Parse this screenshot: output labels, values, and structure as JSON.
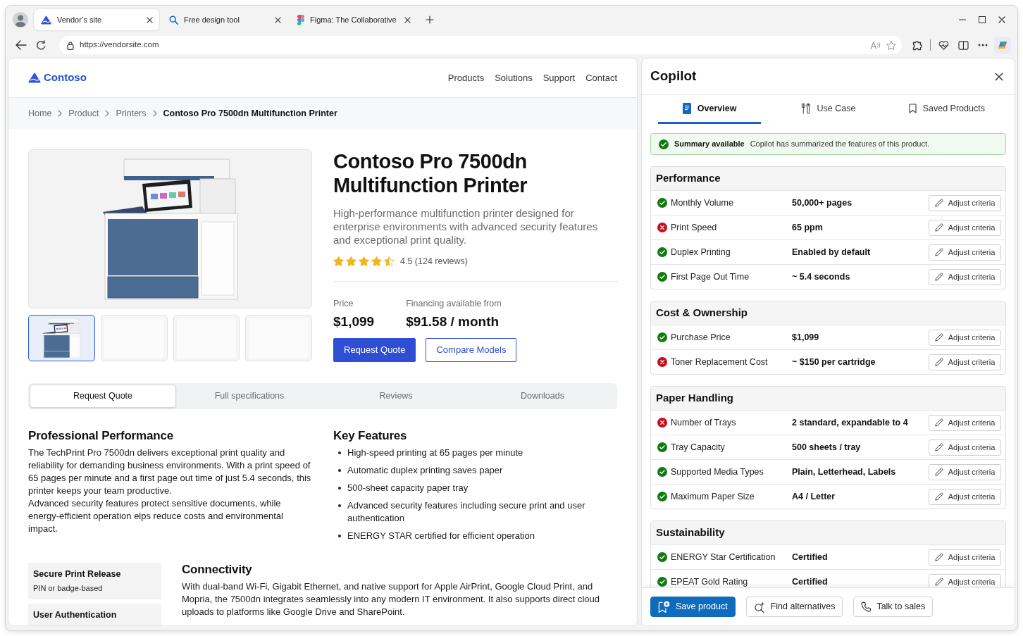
{
  "browser": {
    "tabs": [
      {
        "title": "Vendor’s site",
        "selected": true
      },
      {
        "title": "Free design tool",
        "selected": false
      },
      {
        "title": "Figma: The Collaborative",
        "selected": false
      }
    ],
    "address": "https://vendorsite.com"
  },
  "site": {
    "brand": "Contoso",
    "nav": [
      "Products",
      "Solutions",
      "Support",
      "Contact"
    ],
    "breadcrumb": [
      {
        "label": "Home",
        "current": false
      },
      {
        "label": "Product",
        "current": false
      },
      {
        "label": "Printers",
        "current": false
      },
      {
        "label": "Contoso Pro 7500dn Multifunction Printer",
        "current": true
      }
    ],
    "thumbnails": [
      {
        "selected": true
      },
      {
        "selected": false
      },
      {
        "selected": false
      },
      {
        "selected": false
      }
    ],
    "product": {
      "title": "Contoso Pro 7500dn Multifunction Printer",
      "description": "High-performance multifunction printer designed for enterprise environments with advanced security features and exceptional print quality.",
      "stars": 4.5,
      "rating": "4.5 (124 reviews)",
      "price_label": "Price",
      "price": "$1,099",
      "financing_label": "Financing available from",
      "financing": "$91.58 / month",
      "buttons": [
        {
          "label": "Request Quote",
          "primary": true
        },
        {
          "label": "Compare Models",
          "primary": false
        }
      ]
    },
    "tabs": [
      {
        "label": "Request Quote",
        "selected": true
      },
      {
        "label": "Full specifications",
        "selected": false
      },
      {
        "label": "Reviews",
        "selected": false
      },
      {
        "label": "Downloads",
        "selected": false
      }
    ],
    "overview": {
      "title": "Professional Performance",
      "paragraphs": [
        "The TechPrint Pro 7500dn delivers exceptional print quality and reliability for demanding business environments. With a print speed of 65 pages per minute and a first page out time of just 5.4 seconds, this printer keeps your team productive.",
        "Advanced security features protect sensitive documents, while energy-efficient operation elps reduce costs and environmental impact."
      ]
    },
    "key_features": {
      "title": "Key Features",
      "items": [
        "High-speed printing at 65 pages per minute",
        "Automatic duplex printing saves paper",
        "500-sheet capacity paper tray",
        "Advanced security features including secure print and user authentication",
        "ENERGY STAR certified for efficient operation"
      ]
    },
    "spec_cards": [
      {
        "title": "Secure Print Release",
        "text": "PIN or badge-based"
      },
      {
        "title": "User Authentication"
      }
    ],
    "connectivity": {
      "title": "Connectivity",
      "text": "With dual-band Wi-Fi, Gigabit Ethernet, and native support for Apple AirPrint, Google Cloud Print, and Mopria, the 7500dn integrates seamlessly into any modern IT environment. It also supports direct cloud uploads to platforms like Google Drive and SharePoint."
    }
  },
  "copilot": {
    "title": "Copilot",
    "tabs": [
      {
        "label": "Overview",
        "selected": true
      },
      {
        "label": "Use Case",
        "selected": false
      },
      {
        "label": "Saved Products",
        "selected": false
      }
    ],
    "notice": {
      "title": "Summary available",
      "text": "Copilot has summarized the features of this product."
    },
    "groups": [
      {
        "title": "Performance",
        "rows": [
          {
            "label": "Monthly Volume",
            "value": "50,000+ pages",
            "met": true,
            "action": "Adjust criteria"
          },
          {
            "label": "Print Speed",
            "value": "65 ppm",
            "met": false,
            "action": "Adjust criteria"
          },
          {
            "label": "Duplex Printing",
            "value": "Enabled by default",
            "met": true,
            "action": "Adjust criteria"
          },
          {
            "label": "First Page Out Time",
            "value": "~ 5.4 seconds",
            "met": true,
            "action": "Adjust criteria"
          }
        ]
      },
      {
        "title": "Cost & Ownership",
        "rows": [
          {
            "label": "Purchase Price",
            "value": "$1,099",
            "met": true,
            "action": "Adjust criteria"
          },
          {
            "label": "Toner Replacement Cost",
            "value": "~ $150 per cartridge",
            "met": false,
            "action": "Adjust criteria"
          }
        ]
      },
      {
        "title": "Paper Handling",
        "rows": [
          {
            "label": "Number of Trays",
            "value": "2 standard, expandable to 4",
            "met": false,
            "action": "Adjust criteria"
          },
          {
            "label": "Tray Capacity",
            "value": "500 sheets / tray",
            "met": true,
            "action": "Adjust criteria"
          },
          {
            "label": "Supported Media Types",
            "value": "Plain, Letterhead, Labels",
            "met": true,
            "action": "Adjust criteria"
          },
          {
            "label": "Maximum Paper Size",
            "value": "A4 / Letter",
            "met": true,
            "action": "Adjust criteria"
          }
        ]
      },
      {
        "title": "Sustainability",
        "rows": [
          {
            "label": "ENERGY Star Certification",
            "value": "Certified",
            "met": true,
            "action": "Adjust criteria"
          },
          {
            "label": "EPEAT Gold Rating",
            "value": "Certified",
            "met": true,
            "action": "Adjust criteria"
          }
        ]
      }
    ],
    "actions": [
      {
        "label": "Save product",
        "primary": true
      },
      {
        "label": "Find alternatives",
        "primary": false
      },
      {
        "label": "Talk to sales",
        "primary": false
      }
    ]
  }
}
